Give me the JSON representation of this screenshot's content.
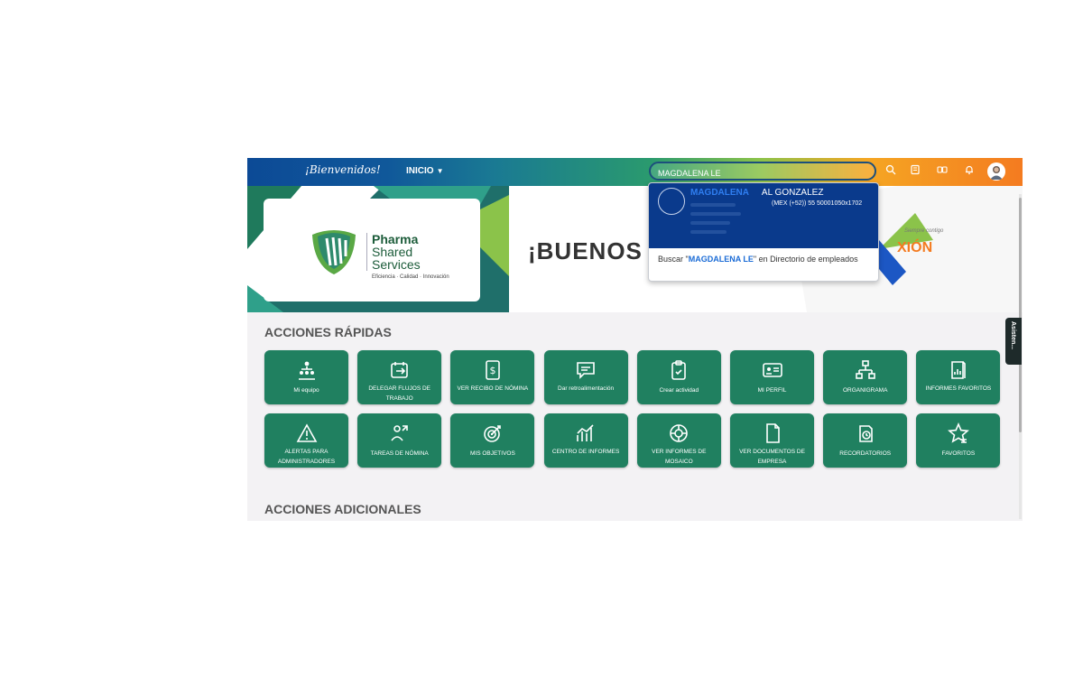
{
  "header": {
    "welcome": "¡Bienvenidos!",
    "nav_label": "INICIO",
    "search_value": "MAGDALENA LE"
  },
  "banner": {
    "logo_line1": "Pharma",
    "logo_line2": "Shared",
    "logo_line3": "Services",
    "logo_tagline": "Eficiencia · Calidad · Innovación",
    "greeting": "¡BUENOS",
    "brand_script": "Siempre contigo",
    "brand_text": "XIÓN"
  },
  "search_dropdown": {
    "result_name_highlight": "MAGDALENA",
    "result_name_rest": "AL GONZALEZ",
    "result_phone": "(MEX (+52)) 55 50001050x1702",
    "directory_prefix": "Buscar \"",
    "directory_query": "MAGDALENA LE",
    "directory_suffix": "\" en Directorio de empleados"
  },
  "quick_actions": {
    "title": "ACCIONES RÁPIDAS",
    "tiles": [
      {
        "label": "Mi equipo",
        "icon": "team-icon"
      },
      {
        "label": "DELEGAR FLUJOS DE TRABAJO",
        "icon": "calendar-delegate-icon"
      },
      {
        "label": "VER RECIBO DE NÓMINA",
        "icon": "payslip-icon"
      },
      {
        "label": "Dar retroalimentación",
        "icon": "feedback-icon"
      },
      {
        "label": "Crear actividad",
        "icon": "clipboard-check-icon"
      },
      {
        "label": "MI PERFIL",
        "icon": "profile-card-icon"
      },
      {
        "label": "ORGANIGRAMA",
        "icon": "org-chart-icon"
      },
      {
        "label": "INFORMES FAVORITOS",
        "icon": "report-star-icon"
      },
      {
        "label": "ALERTAS PARA ADMINISTRADORES",
        "icon": "alert-icon"
      },
      {
        "label": "TAREAS DE NÓMINA",
        "icon": "payroll-task-icon"
      },
      {
        "label": "MIS OBJETIVOS",
        "icon": "target-icon"
      },
      {
        "label": "CENTRO DE INFORMES",
        "icon": "chart-icon"
      },
      {
        "label": "VER INFORMES DE MOSAICO",
        "icon": "tile-report-icon"
      },
      {
        "label": "VER DOCUMENTOS DE EMPRESA",
        "icon": "document-icon"
      },
      {
        "label": "RECORDATORIOS",
        "icon": "reminder-icon"
      },
      {
        "label": "FAVORITOS",
        "icon": "favorites-icon"
      }
    ]
  },
  "additional_actions": {
    "title": "ACCIONES ADICIONALES"
  },
  "assistant_tab": "Asisten..."
}
